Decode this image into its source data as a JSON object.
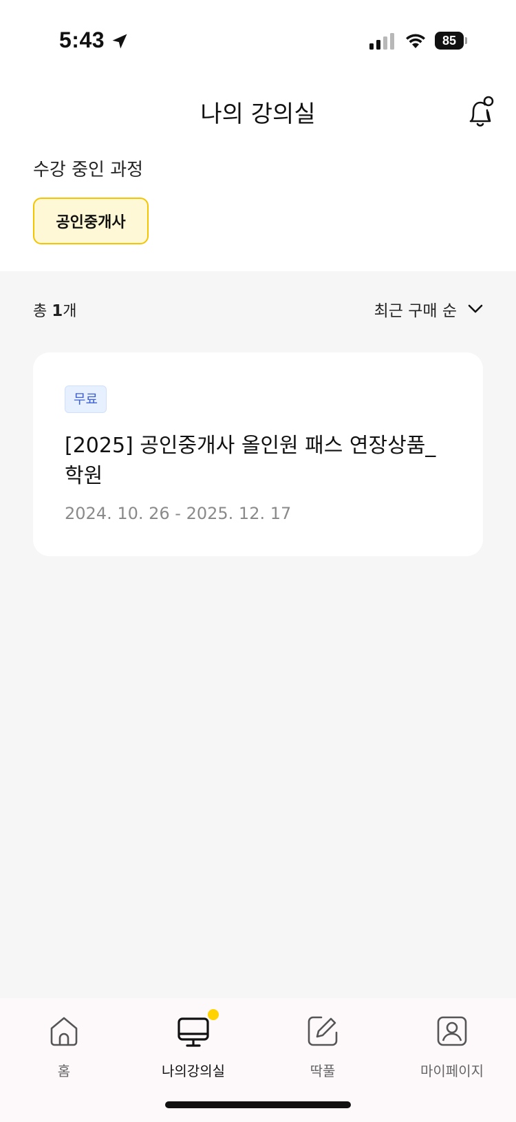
{
  "status": {
    "time": "5:43",
    "battery": "85"
  },
  "header": {
    "title": "나의 강의실"
  },
  "enrolled": {
    "label": "수강 중인 과정",
    "chips": [
      "공인중개사"
    ]
  },
  "list": {
    "count_prefix": "총 ",
    "count_value": "1",
    "count_suffix": "개",
    "sort_label": "최근 구매 순"
  },
  "course": {
    "badge": "무료",
    "title": "[2025] 공인중개사 올인원 패스 연장상품_학원",
    "date_range": "2024. 10. 26 - 2025. 12. 17"
  },
  "tabs": [
    {
      "label": "홈",
      "icon": "home-icon",
      "active": false
    },
    {
      "label": "나의강의실",
      "icon": "monitor-icon",
      "active": true
    },
    {
      "label": "딱풀",
      "icon": "edit-icon",
      "active": false
    },
    {
      "label": "마이페이지",
      "icon": "profile-icon",
      "active": false
    }
  ],
  "colors": {
    "accent": "#f5c400",
    "chip_bg": "#fff8d6",
    "badge_text": "#3d5fd6",
    "badge_bg": "#e7f0ff",
    "content_bg": "#f6f6f6"
  }
}
